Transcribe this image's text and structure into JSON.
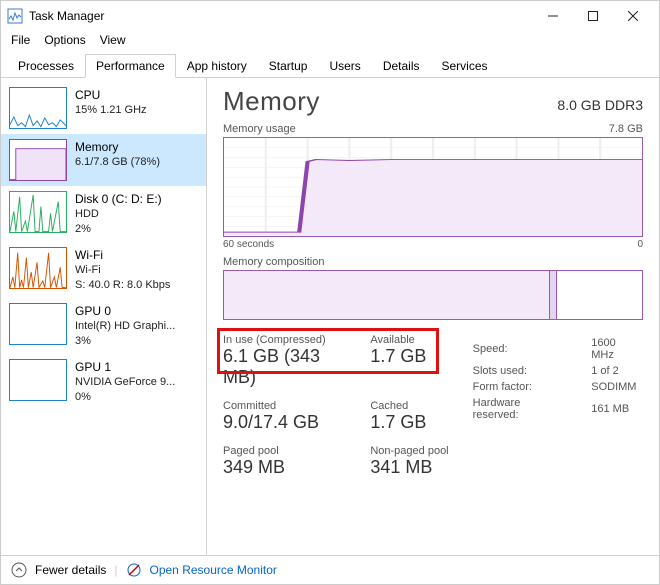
{
  "window": {
    "title": "Task Manager"
  },
  "menu": {
    "file": "File",
    "options": "Options",
    "view": "View"
  },
  "tabs": {
    "processes": "Processes",
    "performance": "Performance",
    "apphistory": "App history",
    "startup": "Startup",
    "users": "Users",
    "details": "Details",
    "services": "Services"
  },
  "sidebar": {
    "cpu": {
      "title": "CPU",
      "line2": "15% 1.21 GHz"
    },
    "memory": {
      "title": "Memory",
      "line2": "6.1/7.8 GB (78%)"
    },
    "disk": {
      "title": "Disk 0 (C: D: E:)",
      "line2": "HDD",
      "line3": "2%"
    },
    "wifi": {
      "title": "Wi-Fi",
      "line2": "Wi-Fi",
      "line3": "S: 40.0 R: 8.0 Kbps"
    },
    "gpu0": {
      "title": "GPU 0",
      "line2": "Intel(R) HD Graphi...",
      "line3": "3%"
    },
    "gpu1": {
      "title": "GPU 1",
      "line2": "NVIDIA GeForce 9...",
      "line3": "0%"
    }
  },
  "header": {
    "title": "Memory",
    "right": "8.0 GB DDR3"
  },
  "usage": {
    "label": "Memory usage",
    "max": "7.8 GB",
    "xleft": "60 seconds",
    "xright": "0"
  },
  "composition": {
    "label": "Memory composition"
  },
  "stats": {
    "inuse_lbl": "In use (Compressed)",
    "inuse_val": "6.1 GB (343 MB)",
    "avail_lbl": "Available",
    "avail_val": "1.7 GB",
    "commit_lbl": "Committed",
    "commit_val": "9.0/17.4 GB",
    "cached_lbl": "Cached",
    "cached_val": "1.7 GB",
    "paged_lbl": "Paged pool",
    "paged_val": "349 MB",
    "nonpaged_lbl": "Non-paged pool",
    "nonpaged_val": "341 MB"
  },
  "right_stats": {
    "speed_lbl": "Speed:",
    "speed_val": "1600 MHz",
    "slots_lbl": "Slots used:",
    "slots_val": "1 of 2",
    "form_lbl": "Form factor:",
    "form_val": "SODIMM",
    "hw_lbl": "Hardware reserved:",
    "hw_val": "161 MB"
  },
  "footer": {
    "fewer": "Fewer details",
    "open": "Open Resource Monitor"
  },
  "chart_data": {
    "type": "line",
    "title": "Memory usage",
    "xlabel": "seconds",
    "ylabel": "GB",
    "xlim": [
      0,
      60
    ],
    "ylim": [
      0,
      7.8
    ],
    "series": [
      {
        "name": "Memory usage",
        "x": [
          60,
          55,
          50,
          48,
          47,
          46,
          45,
          40,
          35,
          30,
          25,
          20,
          15,
          10,
          5,
          0
        ],
        "y": [
          0.3,
          0.3,
          0.3,
          0.3,
          5.9,
          6.1,
          6.1,
          6.1,
          6.0,
          6.1,
          6.1,
          6.1,
          6.1,
          6.1,
          6.1,
          6.1
        ]
      }
    ],
    "composition": {
      "in_use_gb": 6.1,
      "modified_gb": 0.1,
      "standby_free_gb": 1.6,
      "total_gb": 7.8
    }
  }
}
